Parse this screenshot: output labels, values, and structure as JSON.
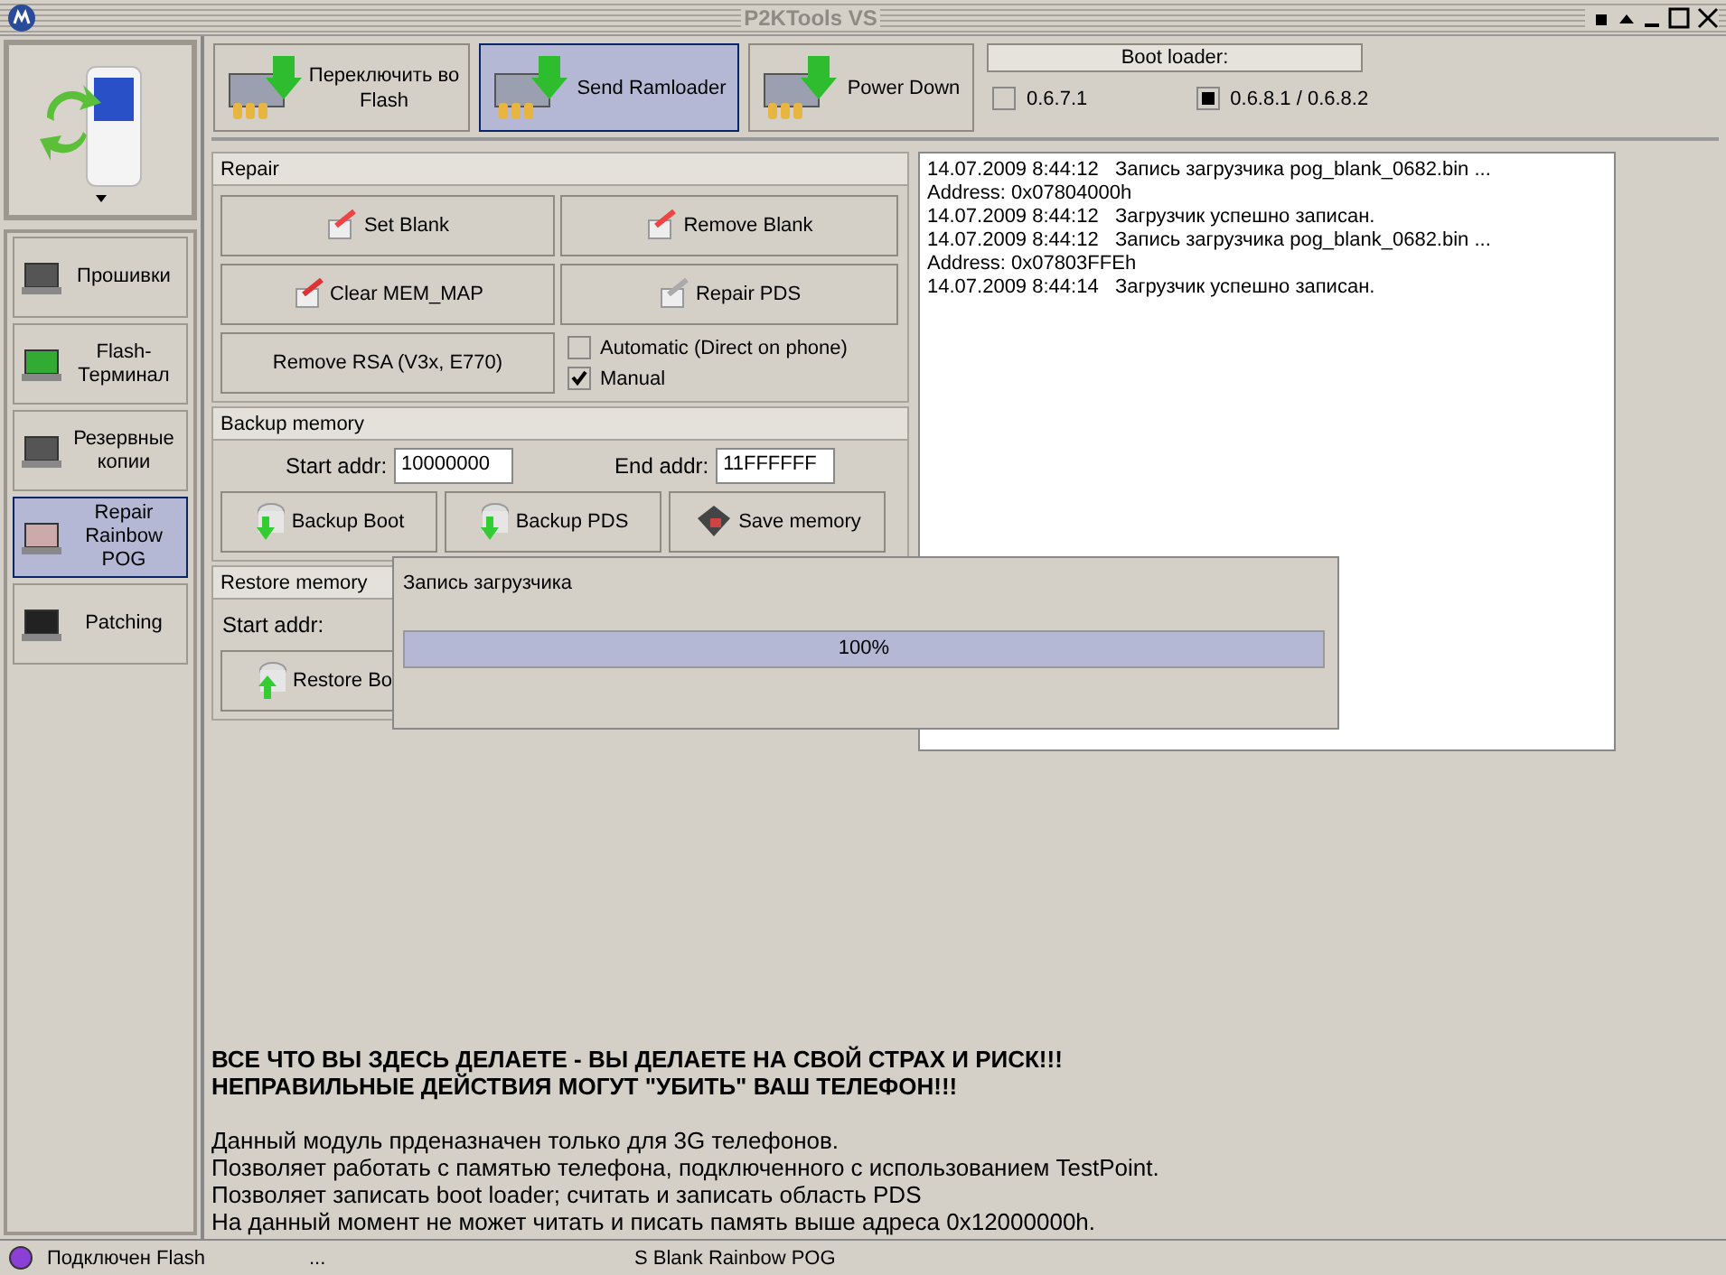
{
  "window": {
    "title": "P2KTools VS"
  },
  "sidebar": {
    "items": [
      {
        "label": "Прошивки",
        "selected": false
      },
      {
        "label": "Flash-Терминал",
        "selected": false
      },
      {
        "label": "Резервные копии",
        "selected": false
      },
      {
        "label": "Repair Rainbow POG",
        "selected": true
      },
      {
        "label": "Patching",
        "selected": false
      }
    ]
  },
  "toolbar": {
    "buttons": [
      {
        "label": "Переключить во Flash",
        "selected": false
      },
      {
        "label": "Send Ramloader",
        "selected": true
      },
      {
        "label": "Power Down",
        "selected": false
      }
    ]
  },
  "boot_loader": {
    "title": "Boot loader:",
    "options": [
      {
        "label": "0.6.7.1",
        "checked": false
      },
      {
        "label": "0.6.8.1 / 0.6.8.2",
        "checked": true
      }
    ]
  },
  "repair": {
    "title": "Repair",
    "buttons": [
      "Set Blank",
      "Remove Blank",
      "Clear MEM_MAP",
      "Repair PDS",
      "Remove RSA (V3x, E770)"
    ],
    "options": [
      {
        "label": "Automatic (Direct on phone)",
        "checked": false
      },
      {
        "label": "Manual",
        "checked": true
      }
    ]
  },
  "backup": {
    "title": "Backup memory",
    "start_label": "Start addr:",
    "start_value": "10000000",
    "end_label": "End addr:",
    "end_value": "11FFFFFF",
    "buttons": [
      "Backup Boot",
      "Backup PDS",
      "Save memory"
    ]
  },
  "restore": {
    "title": "Restore memory",
    "start_label": "Start addr:",
    "buttons": [
      "Restore Bo"
    ]
  },
  "log": {
    "lines": [
      "14.07.2009 8:44:12   Запись загрузчика pog_blank_0682.bin ...",
      "Address: 0x07804000h",
      "14.07.2009 8:44:12   Загрузчик успешно записан.",
      "14.07.2009 8:44:12   Запись загрузчика pog_blank_0682.bin ...",
      "Address: 0x07803FFEh",
      "14.07.2009 8:44:14   Загрузчик успешно записан."
    ]
  },
  "dialog": {
    "title": "Запись загрузчика",
    "level": 1,
    "reading": "100%"
  },
  "notice": {
    "warning": [
      "ВСЕ ЧТО ВЫ ЗДЕСЬ ДЕЛАЕТЕ - ВЫ ДЕЛАЕТЕ НА СВОЙ СТРАХ И РИСК!!!",
      "НЕПРАВИЛЬНЫЕ ДЕЙСТВИЯ МОГУТ \"УБИТЬ\" ВАШ ТЕЛЕФОН!!!"
    ],
    "info": [
      "Данный модуль прденазначен только для 3G телефонов.",
      "Позволяет работать с памятью телефона, подключенного с использованием TestPoint.",
      "Позволяет записать boot loader; считать и записать область PDS",
      "На данный момент не может читать и писать память выше адреса 0x12000000h."
    ]
  },
  "status_bar": {
    "connection": {
      "label": "Подключен Flash",
      "color": "#8b3fd6"
    },
    "field_2": "...",
    "field_3": "S Blank Rainbow POG"
  }
}
